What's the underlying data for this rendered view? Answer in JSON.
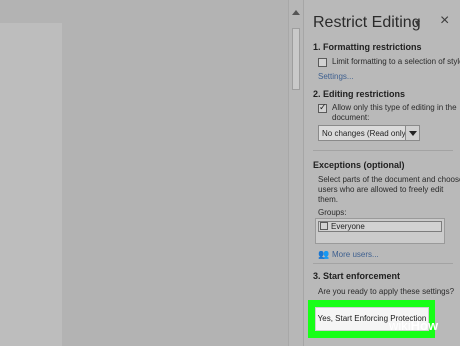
{
  "pane": {
    "title": "Restrict Editing",
    "section1": {
      "heading": "1. Formatting restrictions",
      "checkbox_label": "Limit formatting to a selection of style",
      "checked": false,
      "settings_link": "Settings..."
    },
    "section2": {
      "heading": "2. Editing restrictions",
      "checkbox_line1": "Allow only this type of editing in the",
      "checkbox_line2": "document:",
      "checked": true,
      "select_value": "No changes (Read only)"
    },
    "exceptions": {
      "heading": "Exceptions (optional)",
      "desc_line1": "Select parts of the document and choose",
      "desc_line2": "users who are allowed to freely edit",
      "desc_line3": "them.",
      "groups_label": "Groups:",
      "group_item": "Everyone",
      "more_users": "More users..."
    },
    "section3": {
      "heading": "3. Start enforcement",
      "question": "Are you ready to apply these settings?",
      "button_label": "Yes, Start Enforcing Protection"
    }
  },
  "watermark": {
    "part1": "wiki",
    "part2": "How"
  },
  "colors": {
    "highlight": "#17ff17",
    "link": "#3d5f8f"
  },
  "icons": [
    "chevron-down-icon",
    "close-icon",
    "users-icon",
    "dropdown-arrow-icon",
    "scroll-up-icon"
  ]
}
